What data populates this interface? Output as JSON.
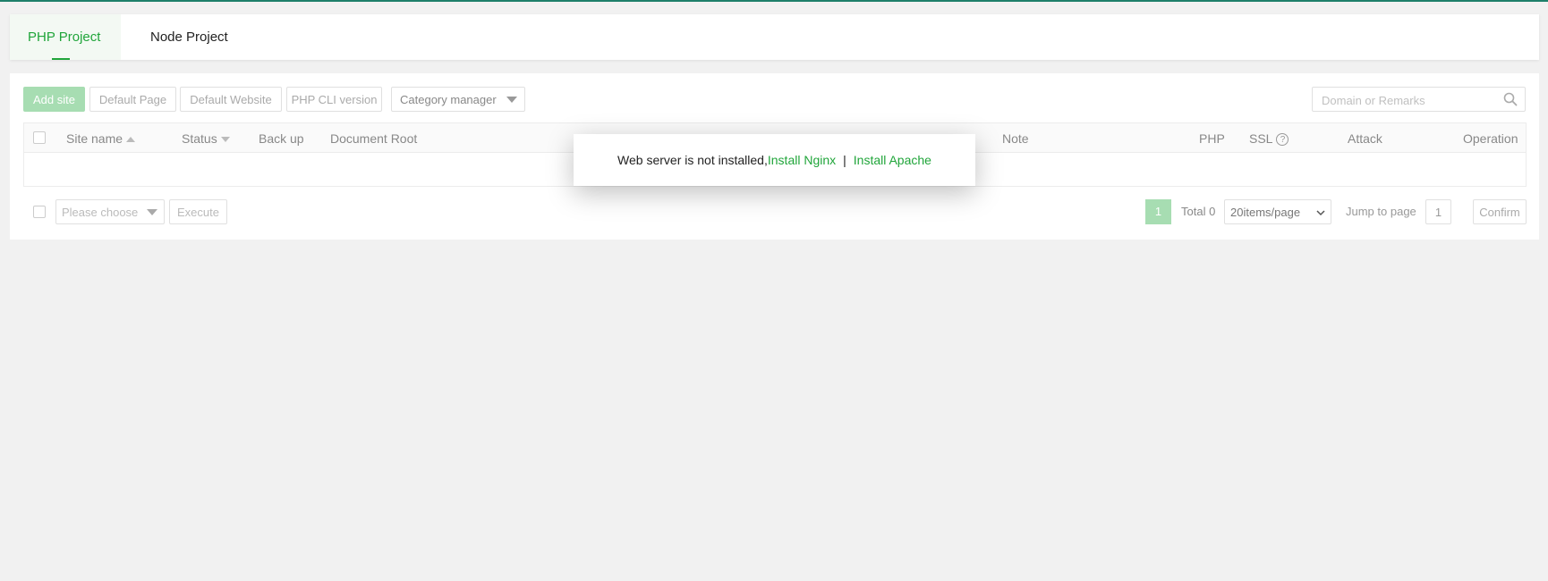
{
  "tabs": [
    {
      "label": "PHP Project",
      "active": true
    },
    {
      "label": "Node Project",
      "active": false
    }
  ],
  "toolbar": {
    "add_site": "Add site",
    "default_page": "Default Page",
    "default_website": "Default Website",
    "php_cli_version": "PHP CLI version",
    "category_manager": "Category manager"
  },
  "search": {
    "placeholder": "Domain or Remarks"
  },
  "table": {
    "columns": {
      "site_name": "Site name",
      "status": "Status",
      "backup": "Back up",
      "document_root": "Document Root",
      "note": "Note",
      "php": "PHP",
      "ssl": "SSL",
      "attack": "Attack",
      "operation": "Operation"
    },
    "help_glyph": "?"
  },
  "footer": {
    "batch_placeholder": "Please choose",
    "execute": "Execute",
    "current_page": "1",
    "total": "Total 0",
    "page_size": "20items/page",
    "jump_label": "Jump to page",
    "jump_value": "1",
    "confirm": "Confirm"
  },
  "modal": {
    "message": "Web server is not installed,",
    "install_nginx": "Install Nginx",
    "separator": "|",
    "install_apache": "Install Apache"
  },
  "colors": {
    "accent": "#20a53a",
    "accent_light": "#a7ddb2",
    "top_bar": "#1e7f6a",
    "background": "#f1f1f1"
  }
}
